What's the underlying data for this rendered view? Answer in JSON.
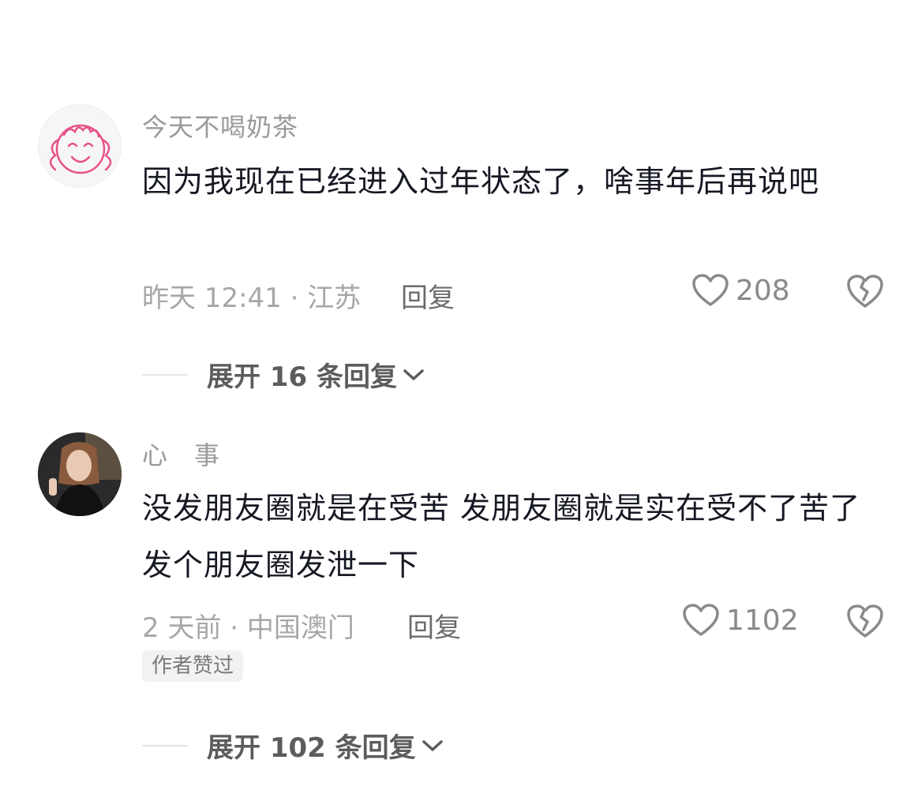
{
  "comments": [
    {
      "username": "今天不喝奶茶",
      "text": "因为我现在已经进入过年状态了，啥事年后再说吧",
      "meta": "昨天 12:41 · 江苏",
      "reply_label": "回复",
      "likes": "208",
      "expand_label": "展开 16 条回复"
    },
    {
      "username": "心　事",
      "text": "没发朋友圈就是在受苦 发朋友圈就是实在受不了苦了 发个朋友圈发泄一下",
      "meta": "2 天前 · 中国澳门",
      "reply_label": "回复",
      "likes": "1102",
      "badge": "作者赞过",
      "expand_label": "展开 102 条回复"
    }
  ],
  "colors": {
    "username": "#9a9a9a",
    "text": "#161823",
    "meta": "#a7a7a7",
    "avatar_doodle": "#e8508a"
  },
  "icons": [
    "heart-icon",
    "broken-heart-icon",
    "chevron-down-icon"
  ]
}
